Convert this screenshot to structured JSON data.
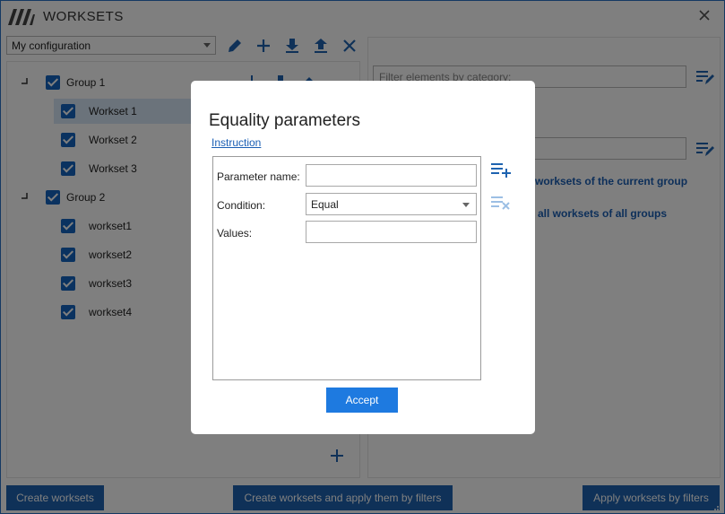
{
  "app": {
    "title": "WORKSETS",
    "config": "My configuration"
  },
  "tree": {
    "groups": [
      {
        "label": "Group 1",
        "items": [
          "Workset 1",
          "Workset 2",
          "Workset 3"
        ]
      },
      {
        "label": "Group 2",
        "items": [
          "workset1",
          "workset2",
          "workset3",
          "workset4"
        ]
      }
    ]
  },
  "right": {
    "filter_placeholder": "Filter elements by category:",
    "link_current_group": "worksets of the current group",
    "link_all_groups": "all worksets of all groups"
  },
  "bottom": {
    "create": "Create worksets",
    "create_apply": "Create worksets and apply them by filters",
    "apply": "Apply worksets by filters"
  },
  "dialog": {
    "title": "Equality parameters",
    "instruction": "Instruction",
    "param_name_label": "Parameter name:",
    "param_name_value": "",
    "condition_label": "Condition:",
    "condition_value": "Equal",
    "values_label": "Values:",
    "values_value": "",
    "accept": "Accept"
  },
  "colors": {
    "accent": "#1e63b0",
    "checkbox": "#1565c0",
    "accept": "#1e7ae0",
    "link": "#1b5fb4"
  }
}
